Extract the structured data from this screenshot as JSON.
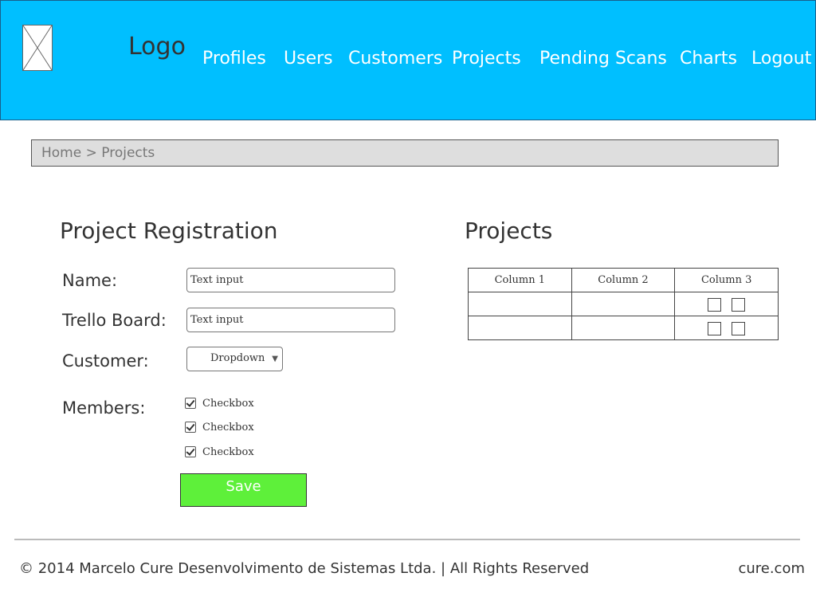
{
  "header": {
    "logo_text": "Logo",
    "nav": [
      {
        "label": "Profiles"
      },
      {
        "label": "Users"
      },
      {
        "label": "Customers"
      },
      {
        "label": "Projects"
      },
      {
        "label": "Pending Scans"
      },
      {
        "label": "Charts"
      },
      {
        "label": "Logout"
      }
    ]
  },
  "breadcrumb": {
    "home": "Home",
    "separator": ">",
    "current": "Projects"
  },
  "form": {
    "title": "Project Registration",
    "name_label": "Name:",
    "name_value": "Text input",
    "trello_label": "Trello Board:",
    "trello_value": "Text input",
    "customer_label": "Customer:",
    "customer_value": "Dropdown",
    "members_label": "Members:",
    "members": [
      {
        "label": "Checkbox",
        "checked": true
      },
      {
        "label": "Checkbox",
        "checked": true
      },
      {
        "label": "Checkbox",
        "checked": true
      }
    ],
    "save_label": "Save"
  },
  "projects": {
    "title": "Projects",
    "columns": [
      "Column 1",
      "Column 2",
      "Column 3"
    ],
    "rows": [
      [
        "",
        ""
      ],
      [
        "",
        ""
      ]
    ]
  },
  "footer": {
    "copyright": "© 2014 Marcelo Cure Desenvolvimento de Sistemas Ltda. | All Rights Reserved",
    "link": "cure.com"
  },
  "colors": {
    "header_bg": "#00bfff",
    "save_button_bg": "#5ef03a",
    "breadcrumb_bg": "#dedede"
  }
}
